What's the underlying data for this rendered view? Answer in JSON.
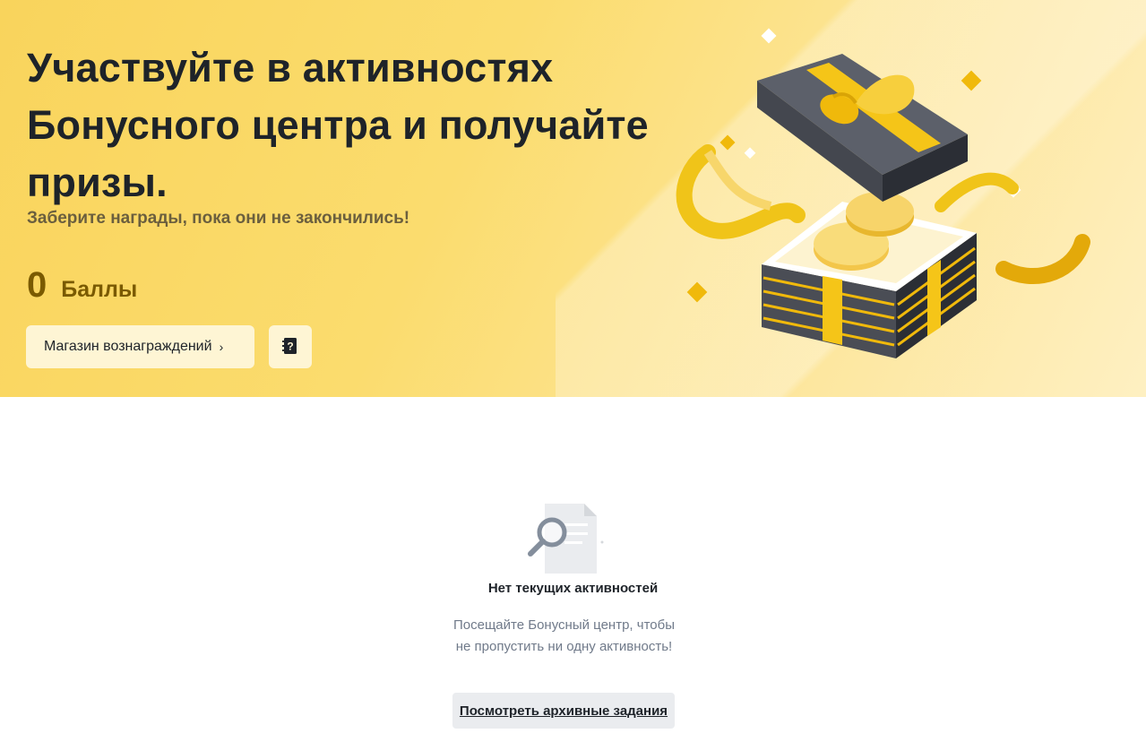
{
  "hero": {
    "title": "Участвуйте в активностях Бонусного центра и получайте призы.",
    "subtitle": "Заберите награды, пока они не закончились!",
    "points_value": "0",
    "points_label": "Баллы",
    "shop_button_label": "Магазин вознаграждений",
    "shop_button_chevron": "›",
    "help_icon": "help-book-icon"
  },
  "empty_state": {
    "illustration_icon": "magnifier-document-icon",
    "title": "Нет текущих активностей",
    "description": "Посещайте Бонусный центр, чтобы не пропустить ни одну активность!",
    "archive_button_label": "Посмотреть архивные задания"
  },
  "colors": {
    "hero_yellow": "#f9d45c",
    "points_brown": "#7a5a00",
    "button_bg": "#fef5d4",
    "muted_text": "#707a8a"
  }
}
